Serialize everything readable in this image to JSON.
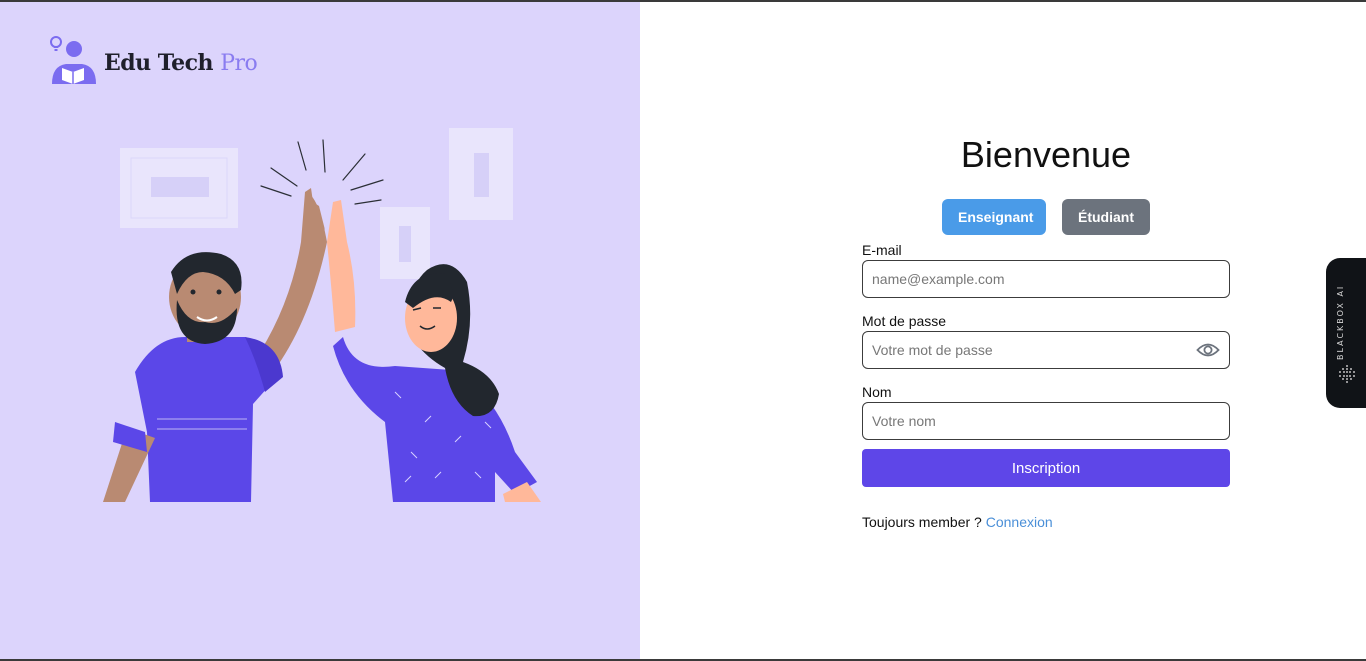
{
  "brand": {
    "name_main": "Edu Tech",
    "name_accent": "Pro",
    "logo_icon": "student-reading-idea-icon"
  },
  "illustration": {
    "subject": "high-five-illustration"
  },
  "form": {
    "title": "Bienvenue",
    "roles": [
      {
        "label": "Enseignant",
        "active": true
      },
      {
        "label": "Étudiant",
        "active": false
      }
    ],
    "email": {
      "label": "E-mail",
      "placeholder": "name@example.com",
      "value": ""
    },
    "password": {
      "label": "Mot de passe",
      "placeholder": "Votre mot de passe",
      "value": "",
      "toggle_icon": "eye-icon"
    },
    "name": {
      "label": "Nom",
      "placeholder": "Votre nom",
      "value": ""
    },
    "submit_label": "Inscription",
    "footer_text": "Toujours member ?",
    "footer_link": "Connexion"
  },
  "side_widget": {
    "label": "BLACKBOX AI",
    "icon": "dot-grid-icon"
  },
  "colors": {
    "left_bg": "#dcd4fc",
    "primary": "#5e46e8",
    "role_active": "#4a9be8",
    "role_inactive": "#6c737d",
    "link": "#4a8fd8",
    "brand_accent": "#8a7cf0"
  }
}
